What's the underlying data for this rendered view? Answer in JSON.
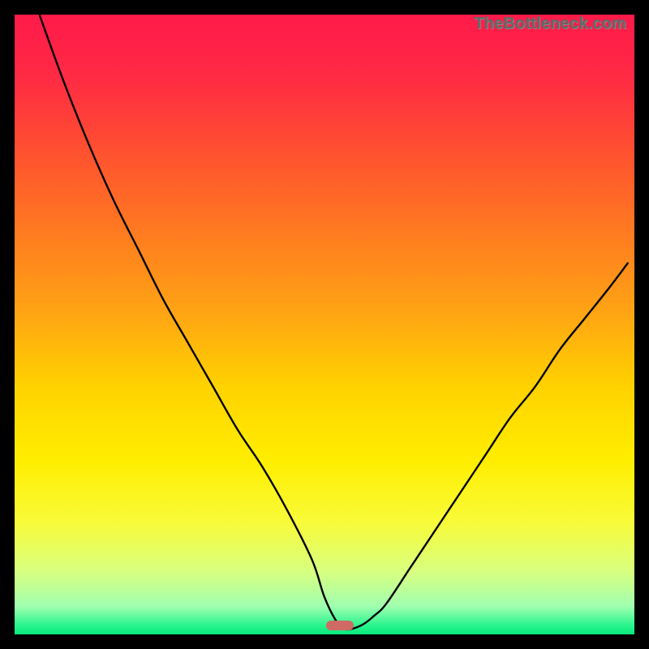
{
  "watermark": "TheBottleneck.com",
  "gradient_stops": [
    {
      "offset": 0.0,
      "color": "#ff1a4a"
    },
    {
      "offset": 0.1,
      "color": "#ff2a44"
    },
    {
      "offset": 0.22,
      "color": "#ff5030"
    },
    {
      "offset": 0.35,
      "color": "#ff7a20"
    },
    {
      "offset": 0.48,
      "color": "#ffa414"
    },
    {
      "offset": 0.6,
      "color": "#ffd200"
    },
    {
      "offset": 0.72,
      "color": "#ffee00"
    },
    {
      "offset": 0.82,
      "color": "#f8fb3a"
    },
    {
      "offset": 0.9,
      "color": "#d7ff81"
    },
    {
      "offset": 0.955,
      "color": "#a0ffb0"
    },
    {
      "offset": 0.985,
      "color": "#2bf58f"
    },
    {
      "offset": 1.0,
      "color": "#07e87b"
    }
  ],
  "chart_data": {
    "type": "line",
    "title": "",
    "xlabel": "",
    "ylabel": "",
    "xlim": [
      0,
      100
    ],
    "ylim": [
      0,
      100
    ],
    "series": [
      {
        "name": "bottleneck-curve",
        "x": [
          4,
          8,
          12,
          16,
          20,
          24,
          28,
          32,
          36,
          40,
          44,
          48,
          50,
          52,
          53.5,
          56,
          58,
          60,
          64,
          68,
          72,
          76,
          80,
          84,
          88,
          92,
          96,
          99
        ],
        "y": [
          100,
          89,
          79,
          70,
          62,
          54,
          47,
          40,
          33,
          27,
          20,
          12,
          6,
          2,
          0.8,
          1.5,
          3,
          5,
          11,
          17,
          23,
          29,
          35,
          40,
          46,
          51,
          56,
          60
        ]
      }
    ],
    "marker": {
      "x": 52.5,
      "y": 1.5
    }
  }
}
